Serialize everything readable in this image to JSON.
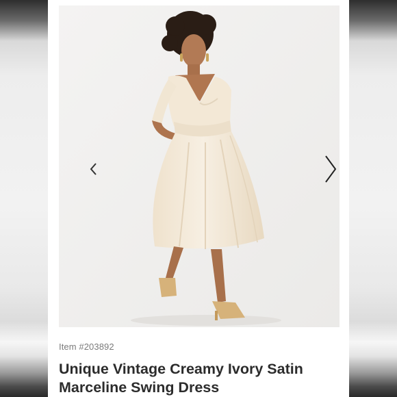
{
  "product": {
    "item_number": "Item #203892",
    "title_line1": "Unique Vintage Creamy Ivory Satin",
    "title_line2": "Marceline Swing Dress"
  },
  "gallery": {
    "prev_icon": "chevron-left-icon",
    "next_icon": "chevron-right-icon",
    "photo_subject": "model-in-ivory-satin-swing-dress"
  },
  "colors": {
    "dress": "#f3e8d6",
    "photo_background": "#f0efee",
    "title_text": "#2c2c2c",
    "meta_text": "#7a7a7a"
  }
}
